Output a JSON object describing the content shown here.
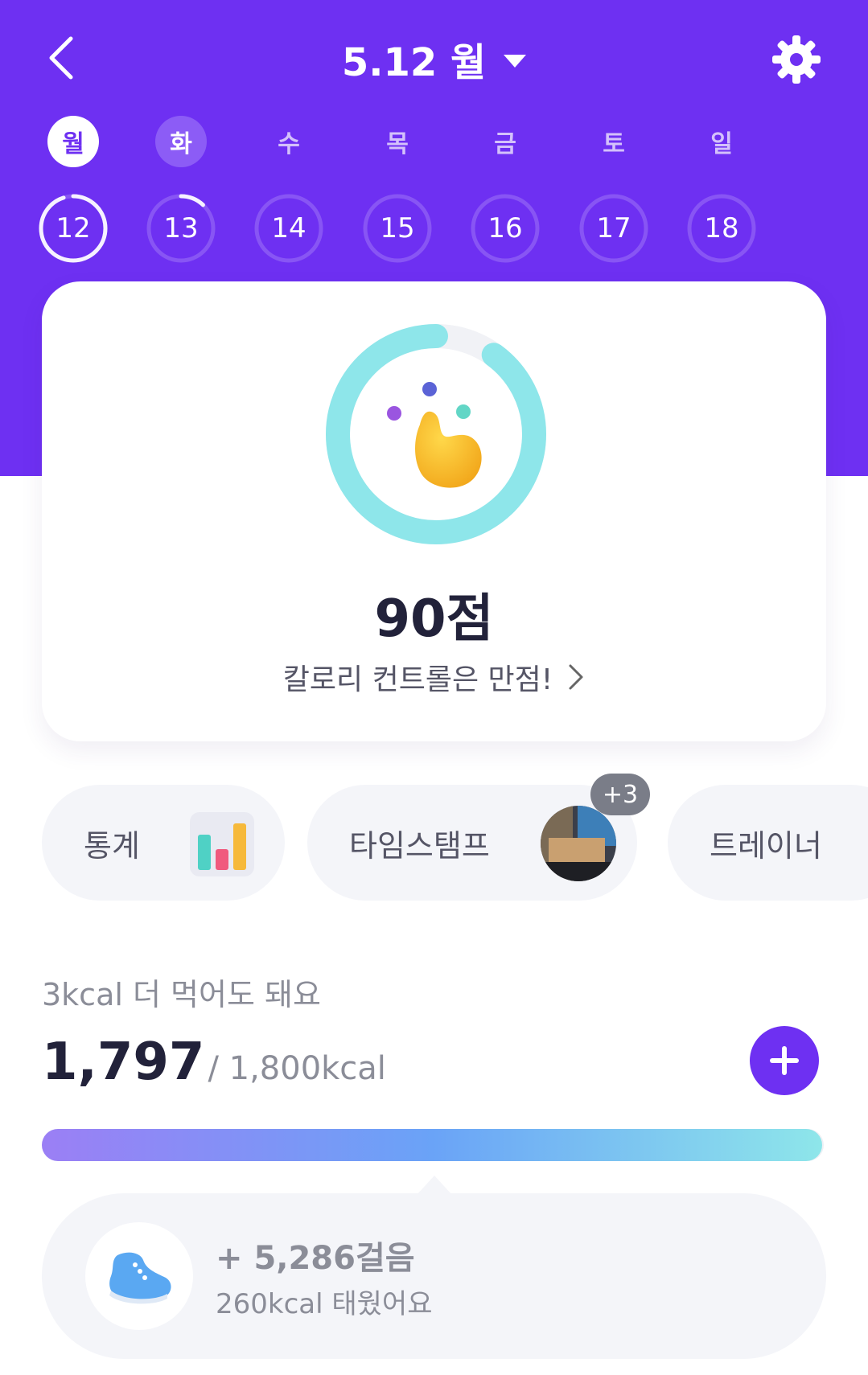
{
  "header": {
    "date_label": "5.12 월",
    "back_icon": "chevron-left-icon",
    "settings_icon": "gear-icon"
  },
  "week": {
    "days": [
      {
        "dow": "월",
        "date": "12",
        "state": "active",
        "progress": 0.95
      },
      {
        "dow": "화",
        "date": "13",
        "state": "selected",
        "progress": 0.12
      },
      {
        "dow": "수",
        "date": "14",
        "state": "none",
        "progress": 0
      },
      {
        "dow": "목",
        "date": "15",
        "state": "none",
        "progress": 0
      },
      {
        "dow": "금",
        "date": "16",
        "state": "none",
        "progress": 0
      },
      {
        "dow": "토",
        "date": "17",
        "state": "none",
        "progress": 0
      },
      {
        "dow": "일",
        "date": "18",
        "state": "none",
        "progress": 0
      }
    ]
  },
  "score": {
    "value_label": "90점",
    "progress": 0.9,
    "message": "칼로리 컨트롤은 만점!"
  },
  "chips": {
    "stats_label": "통계",
    "timestamp_label": "타임스탬프",
    "timestamp_badge": "+3",
    "trainer_label": "트레이너"
  },
  "calories": {
    "remaining_text": "3kcal 더 먹어도 돼요",
    "current": "1,797",
    "target": "/ 1,800kcal",
    "fill_fraction": 0.998
  },
  "steps": {
    "count": "+ 5,286걸음",
    "burned": "260kcal 태웠어요"
  },
  "colors": {
    "brand": "#6e30f2",
    "ring": "#8ee6ea"
  }
}
